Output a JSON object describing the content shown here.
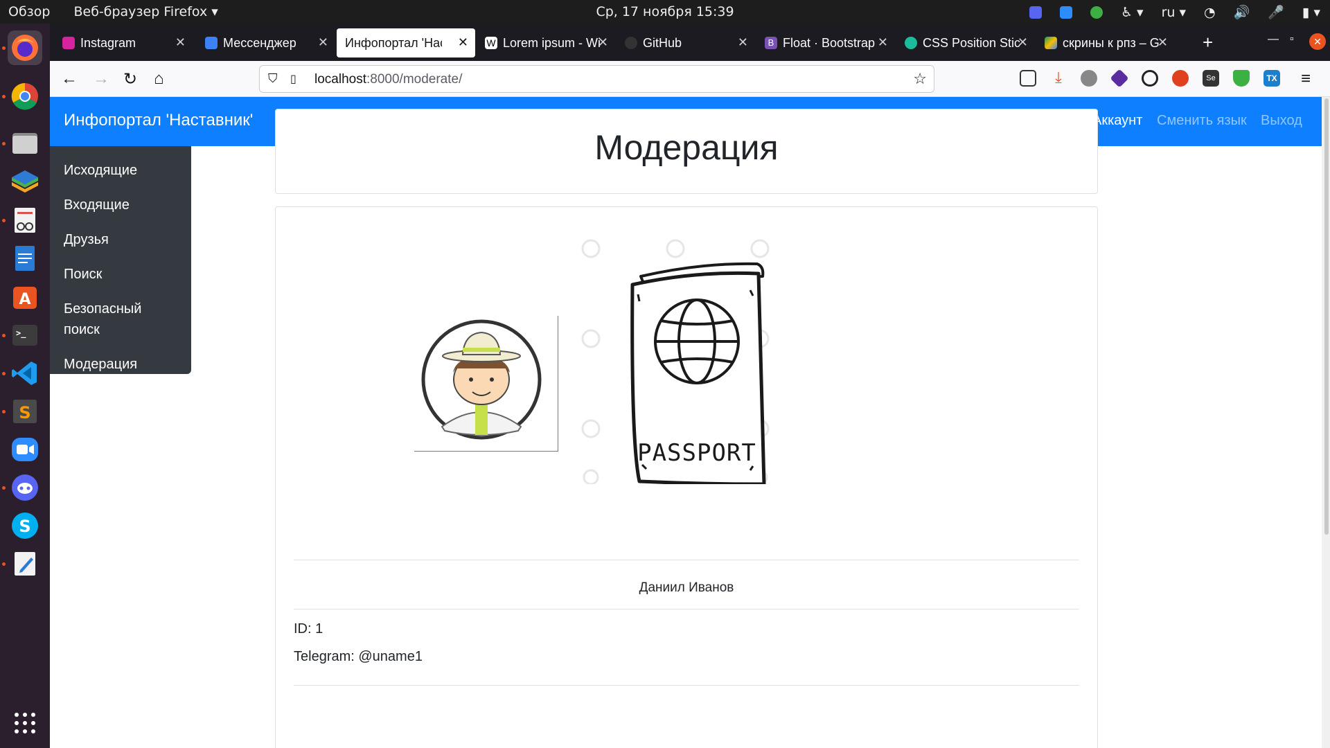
{
  "system_bar": {
    "activities": "Обзор",
    "app_menu": "Веб-браузер Firefox ▾",
    "datetime": "Ср, 17 ноября  15:39",
    "language": "ru ▾"
  },
  "tabs": [
    {
      "title": "Instagram",
      "icon_color": "#d6249f"
    },
    {
      "title": "Мессенджер",
      "icon_color": "#3b82f6"
    },
    {
      "title": "Инфопортал 'Наставник'",
      "icon_color": ""
    },
    {
      "title": "Lorem ipsum - Wikipedia",
      "icon_color": "#ffffff"
    },
    {
      "title": "GitHub",
      "icon_color": "#333333"
    },
    {
      "title": "Float · Bootstrap",
      "icon_color": "#7952b3"
    },
    {
      "title": "CSS Position Sticky",
      "icon_color": "#1abc9c"
    },
    {
      "title": "скрины к рпз – Google Drive",
      "icon_color": "#fbbc04"
    }
  ],
  "url": {
    "host": "localhost",
    "path": ":8000/moderate/"
  },
  "site": {
    "brand": "Инфопортал 'Наставник'",
    "links": {
      "account": "Аккаунт",
      "change_lang": "Сменить язык",
      "logout": "Выход"
    }
  },
  "sidebar": {
    "items": [
      {
        "label": "Исходящие"
      },
      {
        "label": "Входящие"
      },
      {
        "label": "Друзья"
      },
      {
        "label": "Поиск"
      },
      {
        "label": "Безопасный поиск"
      },
      {
        "label": "Модерация"
      }
    ]
  },
  "main": {
    "title": "Модерация",
    "passport_text": "PASSPORT",
    "user": {
      "name": "Даниил Иванов",
      "id": "ID: 1",
      "telegram": "Telegram: @uname1"
    }
  },
  "colors": {
    "brand_blue": "#0d7fff",
    "sidebar_bg": "#343a40",
    "dock_bg": "#2b1f2e",
    "ubuntu_orange": "#e95420"
  }
}
